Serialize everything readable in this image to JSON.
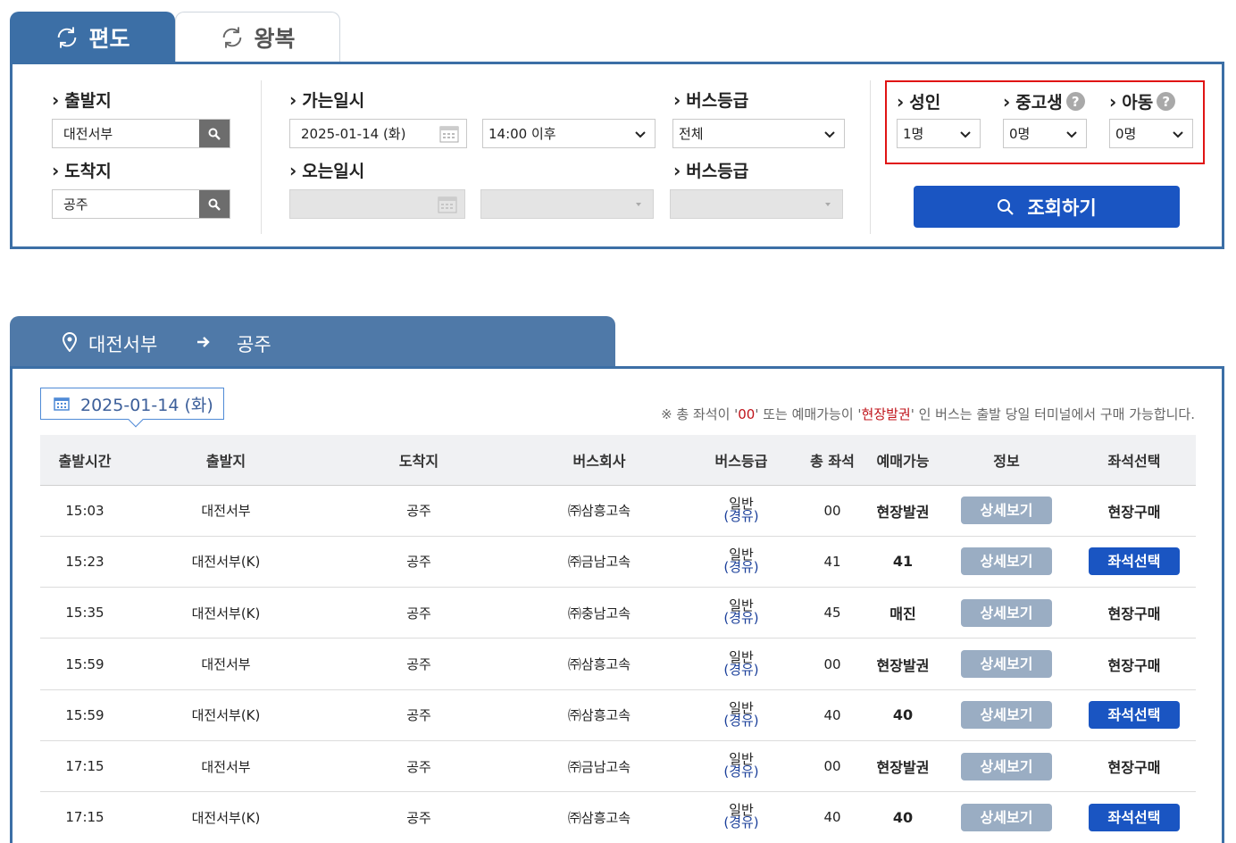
{
  "tabs": {
    "oneway": "편도",
    "roundtrip": "왕복"
  },
  "search": {
    "departure_label": "출발지",
    "departure_value": "대전서부",
    "arrival_label": "도착지",
    "arrival_value": "공주",
    "go_date_label": "가는일시",
    "go_date_value": "2025-01-14 (화)",
    "go_time_value": "14:00 이후",
    "bus_grade_label": "버스등급",
    "bus_grade_value": "전체",
    "return_date_label": "오는일시",
    "return_grade_label": "버스등급",
    "adult_label": "성인",
    "adult_value": "1명",
    "student_label": "중고생",
    "student_value": "0명",
    "child_label": "아동",
    "child_value": "0명",
    "query_button": "조회하기",
    "help_glyph": "?"
  },
  "route": {
    "departure": "대전서부",
    "arrival": "공주"
  },
  "results": {
    "date": "2025-01-14 (화)",
    "notice_prefix": "※ 총 좌석이 '",
    "notice_zero": "00",
    "notice_mid": "' 또는 예매가능이 '",
    "notice_onsite": "현장발권",
    "notice_suffix": "' 인 버스는 출발 당일 터미널에서 구매 가능합니다.",
    "columns": [
      "출발시간",
      "출발지",
      "도착지",
      "버스회사",
      "버스등급",
      "총 좌석",
      "예매가능",
      "정보",
      "좌석선택"
    ],
    "rows": [
      {
        "time": "15:03",
        "from": "대전서부",
        "to": "공주",
        "company": "㈜삼흥고속",
        "grade1": "일반",
        "grade2": "(경유)",
        "seats": "00",
        "available": "현장발권",
        "info": "상세보기",
        "select": "현장구매",
        "select_type": "text"
      },
      {
        "time": "15:23",
        "from": "대전서부(K)",
        "to": "공주",
        "company": "㈜금남고속",
        "grade1": "일반",
        "grade2": "(경유)",
        "seats": "41",
        "available": "41",
        "info": "상세보기",
        "select": "좌석선택",
        "select_type": "button"
      },
      {
        "time": "15:35",
        "from": "대전서부(K)",
        "to": "공주",
        "company": "㈜충남고속",
        "grade1": "일반",
        "grade2": "(경유)",
        "seats": "45",
        "available": "매진",
        "info": "상세보기",
        "select": "현장구매",
        "select_type": "text"
      },
      {
        "time": "15:59",
        "from": "대전서부",
        "to": "공주",
        "company": "㈜삼흥고속",
        "grade1": "일반",
        "grade2": "(경유)",
        "seats": "00",
        "available": "현장발권",
        "info": "상세보기",
        "select": "현장구매",
        "select_type": "text"
      },
      {
        "time": "15:59",
        "from": "대전서부(K)",
        "to": "공주",
        "company": "㈜삼흥고속",
        "grade1": "일반",
        "grade2": "(경유)",
        "seats": "40",
        "available": "40",
        "info": "상세보기",
        "select": "좌석선택",
        "select_type": "button"
      },
      {
        "time": "17:15",
        "from": "대전서부",
        "to": "공주",
        "company": "㈜금남고속",
        "grade1": "일반",
        "grade2": "(경유)",
        "seats": "00",
        "available": "현장발권",
        "info": "상세보기",
        "select": "현장구매",
        "select_type": "text"
      },
      {
        "time": "17:15",
        "from": "대전서부(K)",
        "to": "공주",
        "company": "㈜삼흥고속",
        "grade1": "일반",
        "grade2": "(경유)",
        "seats": "40",
        "available": "40",
        "info": "상세보기",
        "select": "좌석선택",
        "select_type": "button"
      }
    ]
  },
  "colors": {
    "primary": "#3c6fa6",
    "button_blue": "#1a55c2",
    "button_gray": "#9aadc3",
    "highlight_red": "#e01414"
  }
}
